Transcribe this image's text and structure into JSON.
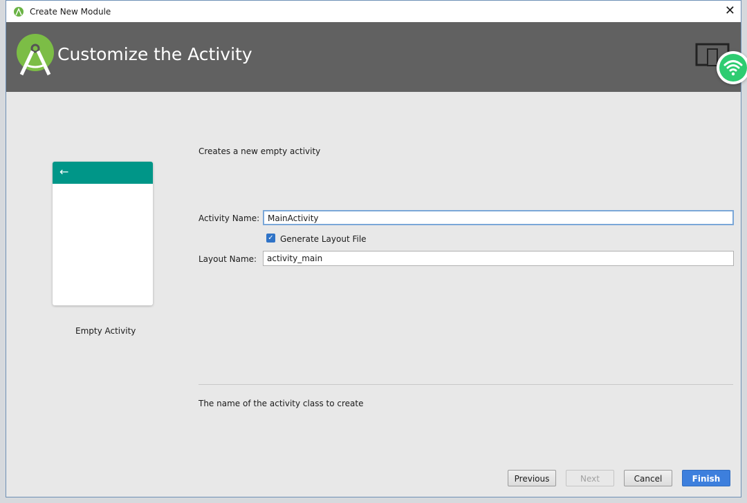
{
  "window": {
    "title": "Create New Module"
  },
  "banner": {
    "title": "Customize the Activity"
  },
  "template": {
    "name": "Empty Activity"
  },
  "form": {
    "description": "Creates a new empty activity",
    "activity_name_label": "Activity Name:",
    "activity_name_value": "MainActivity",
    "generate_layout_label": "Generate Layout File",
    "generate_layout_checked": true,
    "layout_name_label": "Layout Name:",
    "layout_name_value": "activity_main",
    "help_text": "The name of the activity class to create"
  },
  "buttons": {
    "previous": "Previous",
    "next": "Next",
    "cancel": "Cancel",
    "finish": "Finish"
  },
  "colors": {
    "banner": "#616161",
    "accent": "#009688",
    "primary_button": "#3d7fdd",
    "wifi": "#2ecc71"
  }
}
